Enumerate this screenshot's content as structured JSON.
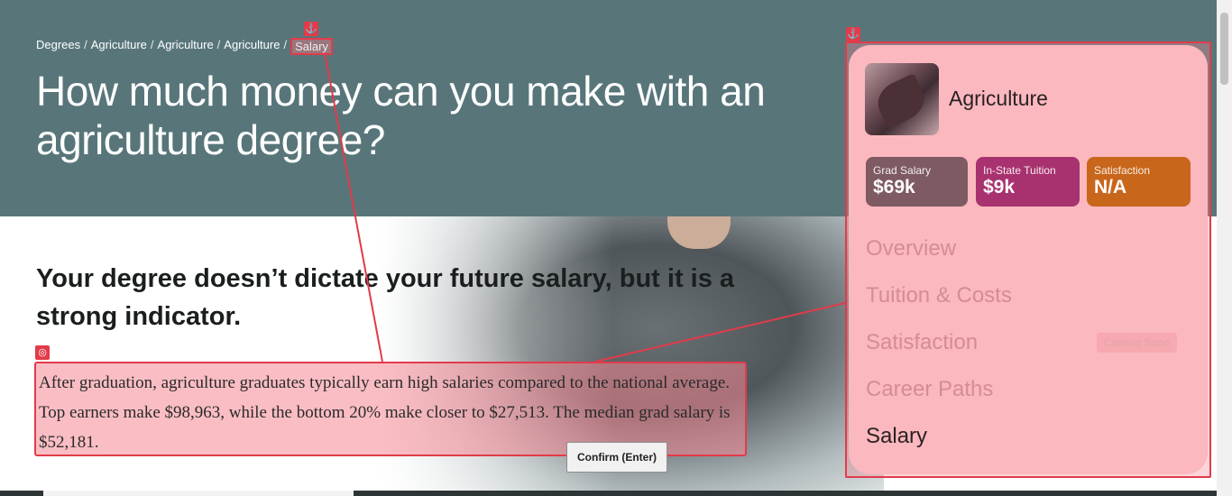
{
  "breadcrumb": {
    "items": [
      "Degrees",
      "Agriculture",
      "Agriculture",
      "Agriculture"
    ],
    "current": "Salary",
    "separator": "/"
  },
  "page_title": "How much money can you make with an agriculture degree?",
  "subhead": "Your degree doesn’t dictate your future salary, but it is a strong indicator.",
  "body_text": "After graduation, agriculture graduates typically earn high salaries compared to the national average. Top earners make $98,963, while the bottom 20% make closer to $27,513. The median grad salary is $52,181.",
  "sidebar": {
    "title": "Agriculture",
    "stats": {
      "salary": {
        "label": "Grad Salary",
        "value": "$69k"
      },
      "tuition": {
        "label": "In-State Tuition",
        "value": "$9k"
      },
      "satisfaction": {
        "label": "Satisfaction",
        "value": "N/A"
      }
    },
    "nav": [
      {
        "label": "Overview"
      },
      {
        "label": "Tuition & Costs"
      },
      {
        "label": "Satisfaction",
        "badge": "Coming Soon"
      },
      {
        "label": "Career Paths"
      },
      {
        "label": "Salary"
      }
    ]
  },
  "confirm_button": "Confirm (Enter)",
  "icons": {
    "anchor": "anchor-icon",
    "target": "target-icon"
  },
  "colors": {
    "hero": "#58767a",
    "highlight_border": "#e23b4a",
    "stat_salary": "#7e5a62",
    "stat_tuition": "#a8326f",
    "stat_satisfaction": "#c8661b"
  }
}
